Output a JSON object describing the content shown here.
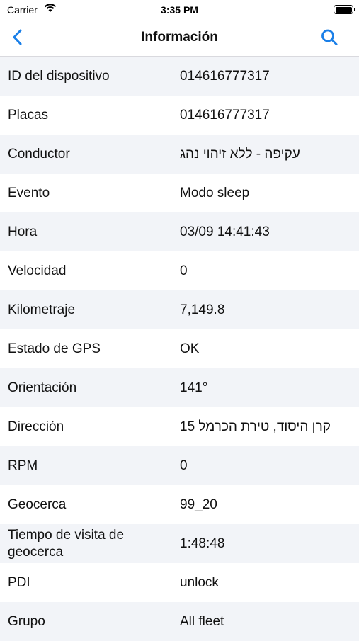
{
  "status": {
    "carrier": "Carrier",
    "time": "3:35 PM"
  },
  "nav": {
    "title": "Información",
    "back_icon": "chevron-left-icon",
    "search_icon": "search-icon"
  },
  "colors": {
    "accent": "#1a7fe8",
    "row_alt": "#f2f4f8"
  },
  "rows": [
    {
      "label": "ID del dispositivo",
      "value": "014616777317"
    },
    {
      "label": "Placas",
      "value": "014616777317"
    },
    {
      "label": "Conductor",
      "value": "עקיפה - ללא זיהוי נהג"
    },
    {
      "label": "Evento",
      "value": "Modo sleep"
    },
    {
      "label": "Hora",
      "value": "03/09 14:41:43"
    },
    {
      "label": "Velocidad",
      "value": "0"
    },
    {
      "label": "Kilometraje",
      "value": "7,149.8"
    },
    {
      "label": "Estado de GPS",
      "value": "OK"
    },
    {
      "label": "Orientación",
      "value": "141°"
    },
    {
      "label": "Dirección",
      "value": "15 קרן היסוד, טירת הכרמל"
    },
    {
      "label": "RPM",
      "value": "0"
    },
    {
      "label": "Geocerca",
      "value": "99_20"
    },
    {
      "label": "Tiempo de visita de geocerca",
      "value": "1:48:48"
    },
    {
      "label": "PDI",
      "value": "unlock"
    },
    {
      "label": "Grupo",
      "value": "All fleet"
    }
  ]
}
